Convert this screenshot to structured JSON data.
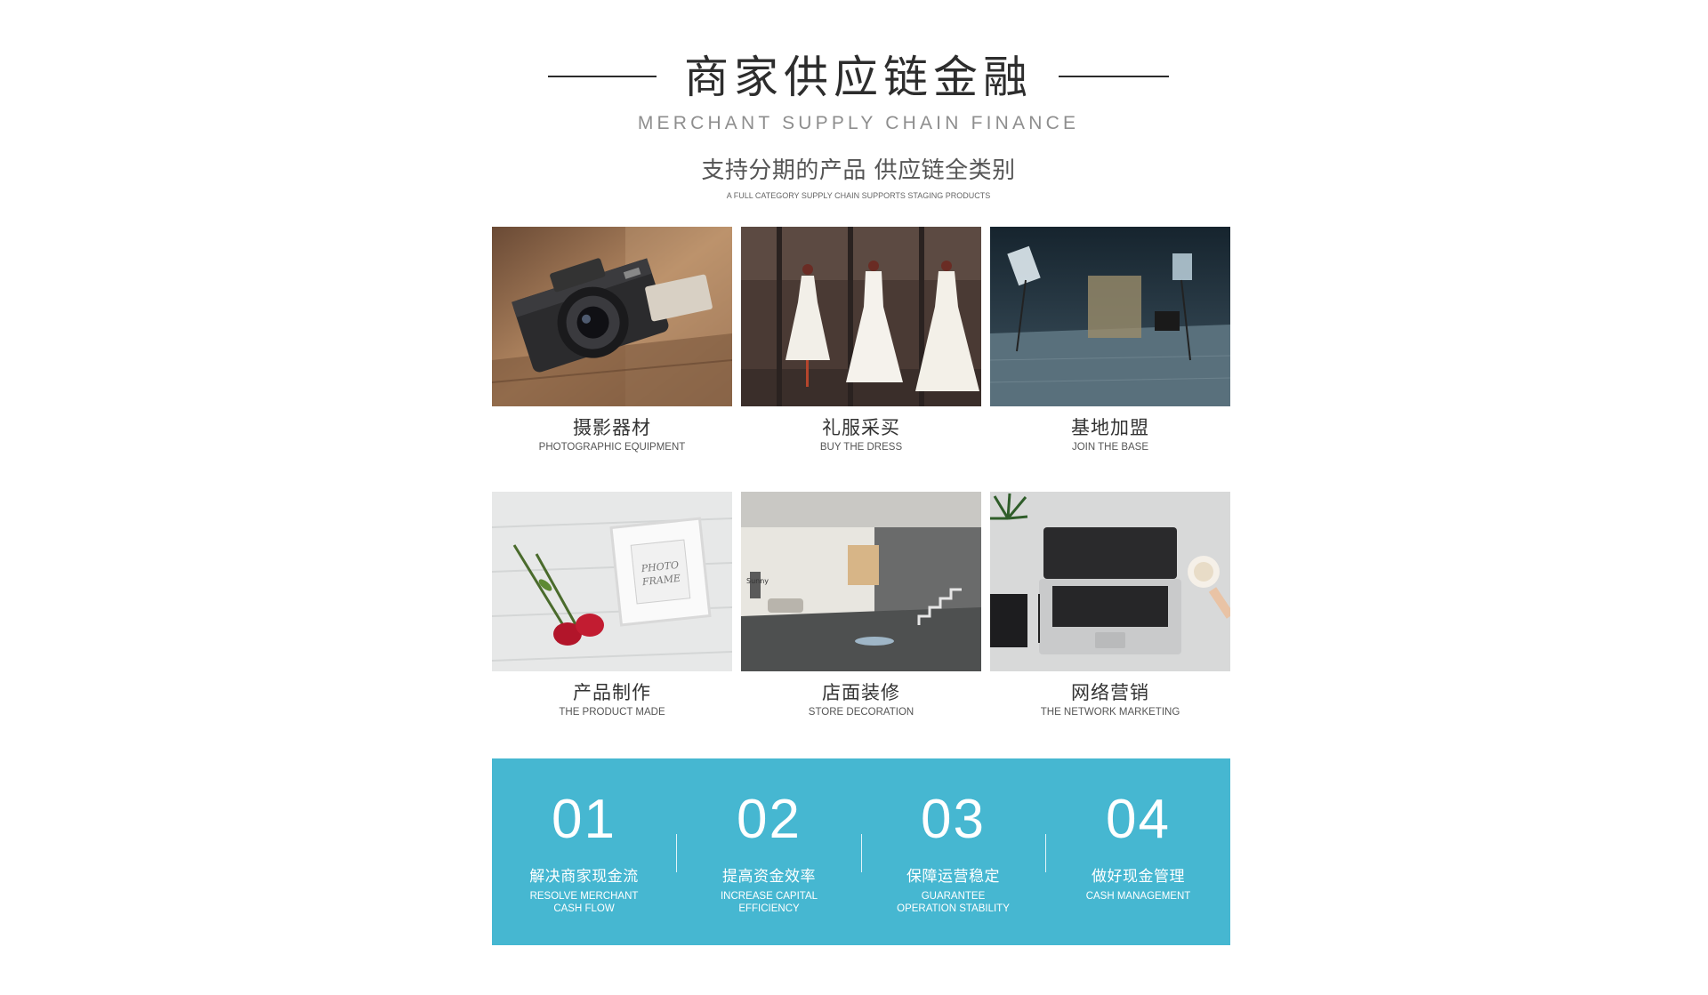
{
  "header": {
    "title": "商家供应链金融",
    "subtitle": "MERCHANT SUPPLY CHAIN FINANCE",
    "tagline": "支持分期的产品 供应链全类别",
    "tagline_en": "A FULL CATEGORY SUPPLY CHAIN SUPPORTS STAGING PRODUCTS"
  },
  "categories": [
    {
      "cn": "摄影器材",
      "en": "PHOTOGRAPHIC EQUIPMENT",
      "image": "camera-photo"
    },
    {
      "cn": "礼服采买",
      "en": "BUY THE DRESS",
      "image": "wedding-dress-photo"
    },
    {
      "cn": "基地加盟",
      "en": "JOIN THE BASE",
      "image": "studio-base-photo"
    },
    {
      "cn": "产品制作",
      "en": "THE PRODUCT MADE",
      "image": "photo-frame-roses-photo"
    },
    {
      "cn": "店面装修",
      "en": "STORE DECORATION",
      "image": "store-interior-photo"
    },
    {
      "cn": "网络营销",
      "en": "THE NETWORK MARKETING",
      "image": "laptop-desk-photo"
    }
  ],
  "benefits": [
    {
      "num": "01",
      "cn": "解决商家现金流",
      "en": "RESOLVE MERCHANT CASH FLOW"
    },
    {
      "num": "02",
      "cn": "提高资金效率",
      "en": "INCREASE CAPITAL EFFICIENCY"
    },
    {
      "num": "03",
      "cn": "保障运营稳定",
      "en": "GUARANTEE OPERATION STABILITY"
    },
    {
      "num": "04",
      "cn": "做好现金管理",
      "en": "CASH MANAGEMENT"
    }
  ],
  "colors": {
    "band": "#46b7d1",
    "title": "#2d2d2d",
    "subtitle": "#8e8e8e"
  }
}
